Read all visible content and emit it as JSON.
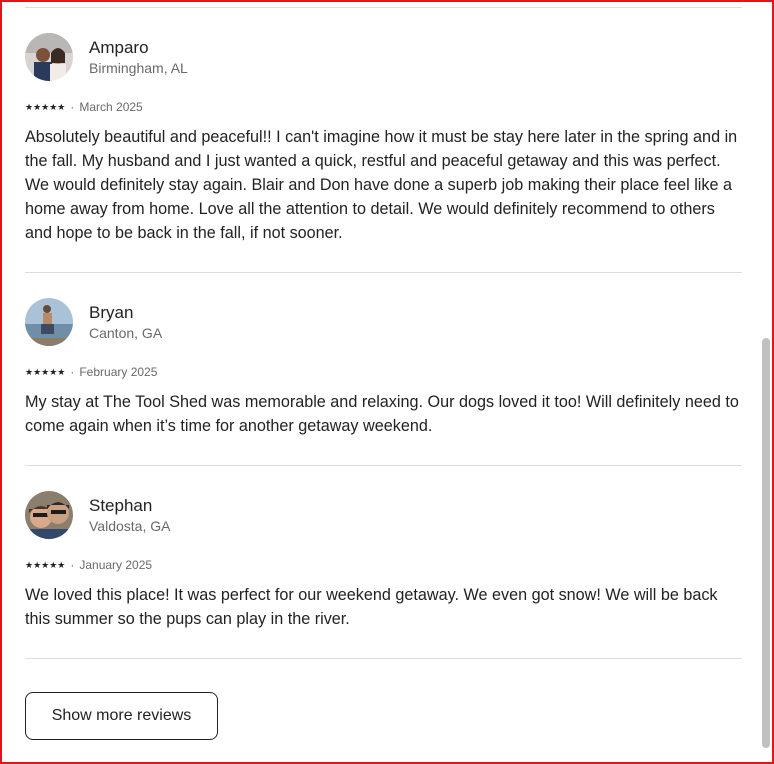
{
  "reviews": [
    {
      "name": "Amparo",
      "location": "Birmingham, AL",
      "rating": 5,
      "stars": "★★★★★",
      "date": "March 2025",
      "text": "Absolutely beautiful and peaceful!! I can't imagine how it must be stay here later in the spring and in the fall. My husband and I just wanted a quick, restful and peaceful getaway and this was perfect. We would definitely stay again. Blair and Don have done a superb job making their place feel like a home away from home. Love all the attention to detail. We would definitely recommend to others and hope to be back in the fall, if not sooner."
    },
    {
      "name": "Bryan",
      "location": "Canton, GA",
      "rating": 5,
      "stars": "★★★★★",
      "date": "February 2025",
      "text": "My stay at The Tool Shed was memorable and relaxing. Our dogs loved it too! Will definitely need to come again when it’s time for another getaway weekend."
    },
    {
      "name": "Stephan",
      "location": "Valdosta, GA",
      "rating": 5,
      "stars": "★★★★★",
      "date": "January 2025",
      "text": "We loved this place! It was perfect for our weekend getaway. We even got snow! We will be back this summer so the pups can play in the river."
    }
  ],
  "separator": "·",
  "show_more_label": "Show more reviews",
  "colors": {
    "frame_border": "#e0161b",
    "text_primary": "#222222",
    "text_secondary": "#6a6a6a",
    "divider": "#dddddd"
  },
  "icons": {
    "star": "star-icon",
    "avatar": "avatar"
  }
}
